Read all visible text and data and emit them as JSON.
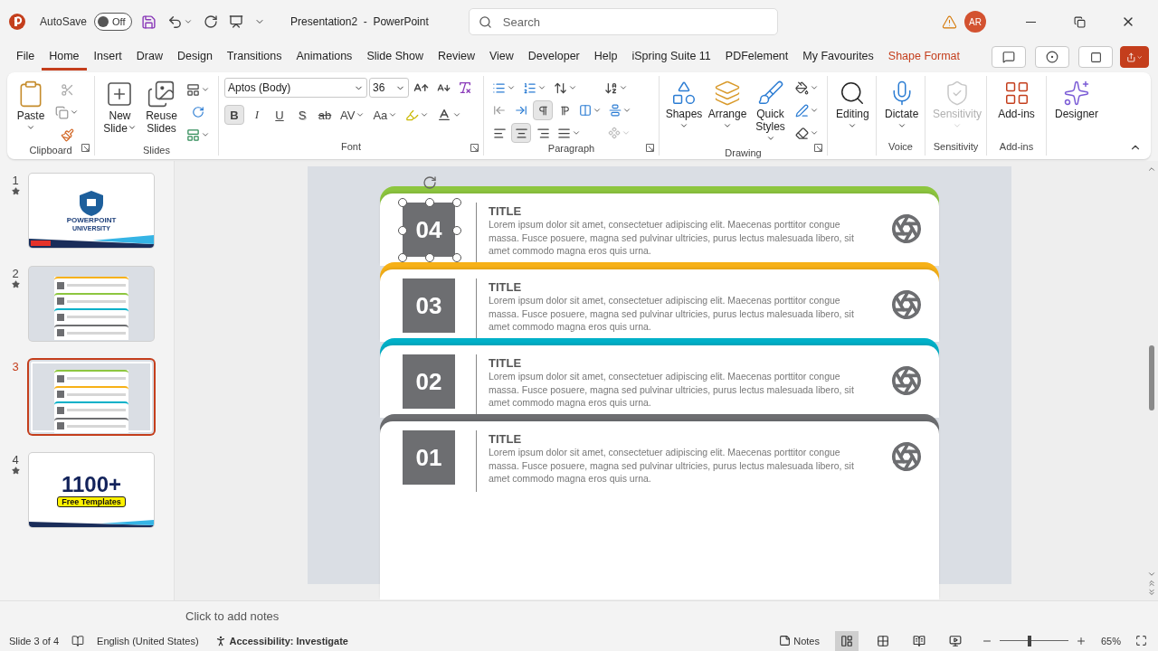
{
  "title_bar": {
    "autosave": {
      "label": "AutoSave",
      "toggle_text": "Off",
      "on": false
    },
    "document_title": "Presentation2  -  PowerPoint",
    "search": {
      "placeholder": "Search"
    },
    "avatar": "AR"
  },
  "menu_tabs": [
    {
      "label": "File",
      "selected": false,
      "kind": "normal"
    },
    {
      "label": "Home",
      "selected": true,
      "kind": "normal"
    },
    {
      "label": "Insert",
      "selected": false,
      "kind": "normal"
    },
    {
      "label": "Draw",
      "selected": false,
      "kind": "normal"
    },
    {
      "label": "Design",
      "selected": false,
      "kind": "normal"
    },
    {
      "label": "Transitions",
      "selected": false,
      "kind": "normal"
    },
    {
      "label": "Animations",
      "selected": false,
      "kind": "normal"
    },
    {
      "label": "Slide Show",
      "selected": false,
      "kind": "normal"
    },
    {
      "label": "Review",
      "selected": false,
      "kind": "normal"
    },
    {
      "label": "View",
      "selected": false,
      "kind": "normal"
    },
    {
      "label": "Developer",
      "selected": false,
      "kind": "normal"
    },
    {
      "label": "Help",
      "selected": false,
      "kind": "normal"
    },
    {
      "label": "iSpring Suite 11",
      "selected": false,
      "kind": "normal"
    },
    {
      "label": "PDFelement",
      "selected": false,
      "kind": "normal"
    },
    {
      "label": "My Favourites",
      "selected": false,
      "kind": "normal"
    },
    {
      "label": "Shape Format",
      "selected": false,
      "kind": "contextual"
    }
  ],
  "ribbon": {
    "clipboard": {
      "name": "Clipboard",
      "paste": "Paste"
    },
    "slides": {
      "name": "Slides",
      "new_slide": "New Slide",
      "reuse_slides": "Reuse Slides"
    },
    "font": {
      "name": "Font",
      "font_name": "Aptos (Body)",
      "font_size": "36",
      "format_buttons": [
        {
          "text": "B",
          "kind": "bold",
          "pressed": true
        },
        {
          "text": "I",
          "kind": "italic",
          "pressed": false
        },
        {
          "text": "U",
          "kind": "underline",
          "pressed": false
        },
        {
          "text": "S",
          "kind": "shadow",
          "pressed": false
        },
        {
          "text": "ab",
          "kind": "strike",
          "pressed": false
        },
        {
          "text": "AV",
          "kind": "spacing",
          "pressed": false
        },
        {
          "text": "Aa",
          "kind": "case",
          "pressed": false
        }
      ]
    },
    "paragraph": {
      "name": "Paragraph",
      "directions": [
        {
          "selected": true
        },
        {
          "selected": false
        }
      ],
      "alignments": [
        {
          "selected": false
        },
        {
          "selected": true
        },
        {
          "selected": false
        },
        {
          "selected": false
        }
      ]
    },
    "drawing": {
      "name": "Drawing",
      "shapes": "Shapes",
      "arrange": "Arrange",
      "quick_styles": "Quick Styles"
    },
    "editing": {
      "label": "Editing"
    },
    "voice": {
      "name": "Voice",
      "dictate": "Dictate"
    },
    "sensitivity": {
      "name": "Sensitivity",
      "button": {
        "label": "Sensitivity",
        "disabled": true
      }
    },
    "add_ins": {
      "name": "Add-ins",
      "button": "Add-ins"
    },
    "designer": {
      "label": "Designer"
    }
  },
  "slides": [
    {
      "number": "1",
      "starred": true,
      "selected": false,
      "kind": "title",
      "texts": [
        "POWERPOINT",
        "UNIVERSITY"
      ]
    },
    {
      "number": "2",
      "starred": true,
      "selected": false,
      "kind": "list",
      "bands": [
        {
          "color": "#f7b117"
        },
        {
          "color": "#8dc63f"
        },
        {
          "color": "#00b0c8"
        },
        {
          "color": "#6d6e71"
        }
      ]
    },
    {
      "number": "3",
      "starred": false,
      "selected": true,
      "kind": "list",
      "bands": [
        {
          "color": "#8dc63f"
        },
        {
          "color": "#f7b117"
        },
        {
          "color": "#00b0c8"
        },
        {
          "color": "#6d6e71"
        }
      ]
    },
    {
      "number": "4",
      "starred": true,
      "selected": false,
      "kind": "promo",
      "texts": [
        "1100+",
        "Free Templates"
      ]
    }
  ],
  "slide": {
    "rows": [
      {
        "number": "04",
        "title": "TITLE",
        "body": "Lorem ipsum dolor sit amet, consectetuer adipiscing elit. Maecenas porttitor congue massa. Fusce posuere, magna sed pulvinar ultricies, purus lectus malesuada libero, sit amet commodo magna eros quis urna.",
        "color": "#8dc63f",
        "selected": true
      },
      {
        "number": "03",
        "title": "TITLE",
        "body": "Lorem ipsum dolor sit amet, consectetuer adipiscing elit. Maecenas porttitor congue massa. Fusce posuere, magna sed pulvinar ultricies, purus lectus malesuada libero, sit amet commodo magna eros quis urna.",
        "color": "#f7b117",
        "selected": false
      },
      {
        "number": "02",
        "title": "TITLE",
        "body": "Lorem ipsum dolor sit amet, consectetuer adipiscing elit. Maecenas porttitor congue massa. Fusce posuere, magna sed pulvinar ultricies, purus lectus malesuada libero, sit amet commodo magna eros quis urna.",
        "color": "#00b0c8",
        "selected": false
      },
      {
        "number": "01",
        "title": "TITLE",
        "body": "Lorem ipsum dolor sit amet, consectetuer adipiscing elit. Maecenas porttitor congue massa. Fusce posuere, magna sed pulvinar ultricies, purus lectus malesuada libero, sit amet commodo magna eros quis urna.",
        "color": "#6d6e71",
        "selected": false
      }
    ]
  },
  "notes": {
    "placeholder": "Click to add notes"
  },
  "status_bar": {
    "slide_position": "Slide 3 of 4",
    "language": "English (United States)",
    "accessibility": "Accessibility: Investigate",
    "notes_button": "Notes",
    "views": [
      {
        "selected": true
      },
      {
        "selected": false
      },
      {
        "selected": false
      },
      {
        "selected": false
      }
    ],
    "zoom": {
      "level": 0.43,
      "reading": "65%"
    }
  }
}
